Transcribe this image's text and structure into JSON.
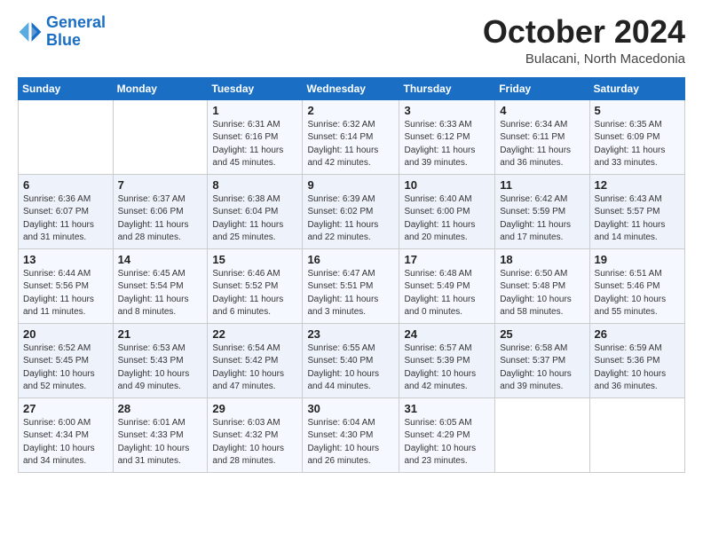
{
  "logo": {
    "line1": "General",
    "line2": "Blue"
  },
  "title": "October 2024",
  "subtitle": "Bulacani, North Macedonia",
  "days_header": [
    "Sunday",
    "Monday",
    "Tuesday",
    "Wednesday",
    "Thursday",
    "Friday",
    "Saturday"
  ],
  "weeks": [
    [
      {
        "day": "",
        "sunrise": "",
        "sunset": "",
        "daylight": ""
      },
      {
        "day": "",
        "sunrise": "",
        "sunset": "",
        "daylight": ""
      },
      {
        "day": "1",
        "sunrise": "Sunrise: 6:31 AM",
        "sunset": "Sunset: 6:16 PM",
        "daylight": "Daylight: 11 hours and 45 minutes."
      },
      {
        "day": "2",
        "sunrise": "Sunrise: 6:32 AM",
        "sunset": "Sunset: 6:14 PM",
        "daylight": "Daylight: 11 hours and 42 minutes."
      },
      {
        "day": "3",
        "sunrise": "Sunrise: 6:33 AM",
        "sunset": "Sunset: 6:12 PM",
        "daylight": "Daylight: 11 hours and 39 minutes."
      },
      {
        "day": "4",
        "sunrise": "Sunrise: 6:34 AM",
        "sunset": "Sunset: 6:11 PM",
        "daylight": "Daylight: 11 hours and 36 minutes."
      },
      {
        "day": "5",
        "sunrise": "Sunrise: 6:35 AM",
        "sunset": "Sunset: 6:09 PM",
        "daylight": "Daylight: 11 hours and 33 minutes."
      }
    ],
    [
      {
        "day": "6",
        "sunrise": "Sunrise: 6:36 AM",
        "sunset": "Sunset: 6:07 PM",
        "daylight": "Daylight: 11 hours and 31 minutes."
      },
      {
        "day": "7",
        "sunrise": "Sunrise: 6:37 AM",
        "sunset": "Sunset: 6:06 PM",
        "daylight": "Daylight: 11 hours and 28 minutes."
      },
      {
        "day": "8",
        "sunrise": "Sunrise: 6:38 AM",
        "sunset": "Sunset: 6:04 PM",
        "daylight": "Daylight: 11 hours and 25 minutes."
      },
      {
        "day": "9",
        "sunrise": "Sunrise: 6:39 AM",
        "sunset": "Sunset: 6:02 PM",
        "daylight": "Daylight: 11 hours and 22 minutes."
      },
      {
        "day": "10",
        "sunrise": "Sunrise: 6:40 AM",
        "sunset": "Sunset: 6:00 PM",
        "daylight": "Daylight: 11 hours and 20 minutes."
      },
      {
        "day": "11",
        "sunrise": "Sunrise: 6:42 AM",
        "sunset": "Sunset: 5:59 PM",
        "daylight": "Daylight: 11 hours and 17 minutes."
      },
      {
        "day": "12",
        "sunrise": "Sunrise: 6:43 AM",
        "sunset": "Sunset: 5:57 PM",
        "daylight": "Daylight: 11 hours and 14 minutes."
      }
    ],
    [
      {
        "day": "13",
        "sunrise": "Sunrise: 6:44 AM",
        "sunset": "Sunset: 5:56 PM",
        "daylight": "Daylight: 11 hours and 11 minutes."
      },
      {
        "day": "14",
        "sunrise": "Sunrise: 6:45 AM",
        "sunset": "Sunset: 5:54 PM",
        "daylight": "Daylight: 11 hours and 8 minutes."
      },
      {
        "day": "15",
        "sunrise": "Sunrise: 6:46 AM",
        "sunset": "Sunset: 5:52 PM",
        "daylight": "Daylight: 11 hours and 6 minutes."
      },
      {
        "day": "16",
        "sunrise": "Sunrise: 6:47 AM",
        "sunset": "Sunset: 5:51 PM",
        "daylight": "Daylight: 11 hours and 3 minutes."
      },
      {
        "day": "17",
        "sunrise": "Sunrise: 6:48 AM",
        "sunset": "Sunset: 5:49 PM",
        "daylight": "Daylight: 11 hours and 0 minutes."
      },
      {
        "day": "18",
        "sunrise": "Sunrise: 6:50 AM",
        "sunset": "Sunset: 5:48 PM",
        "daylight": "Daylight: 10 hours and 58 minutes."
      },
      {
        "day": "19",
        "sunrise": "Sunrise: 6:51 AM",
        "sunset": "Sunset: 5:46 PM",
        "daylight": "Daylight: 10 hours and 55 minutes."
      }
    ],
    [
      {
        "day": "20",
        "sunrise": "Sunrise: 6:52 AM",
        "sunset": "Sunset: 5:45 PM",
        "daylight": "Daylight: 10 hours and 52 minutes."
      },
      {
        "day": "21",
        "sunrise": "Sunrise: 6:53 AM",
        "sunset": "Sunset: 5:43 PM",
        "daylight": "Daylight: 10 hours and 49 minutes."
      },
      {
        "day": "22",
        "sunrise": "Sunrise: 6:54 AM",
        "sunset": "Sunset: 5:42 PM",
        "daylight": "Daylight: 10 hours and 47 minutes."
      },
      {
        "day": "23",
        "sunrise": "Sunrise: 6:55 AM",
        "sunset": "Sunset: 5:40 PM",
        "daylight": "Daylight: 10 hours and 44 minutes."
      },
      {
        "day": "24",
        "sunrise": "Sunrise: 6:57 AM",
        "sunset": "Sunset: 5:39 PM",
        "daylight": "Daylight: 10 hours and 42 minutes."
      },
      {
        "day": "25",
        "sunrise": "Sunrise: 6:58 AM",
        "sunset": "Sunset: 5:37 PM",
        "daylight": "Daylight: 10 hours and 39 minutes."
      },
      {
        "day": "26",
        "sunrise": "Sunrise: 6:59 AM",
        "sunset": "Sunset: 5:36 PM",
        "daylight": "Daylight: 10 hours and 36 minutes."
      }
    ],
    [
      {
        "day": "27",
        "sunrise": "Sunrise: 6:00 AM",
        "sunset": "Sunset: 4:34 PM",
        "daylight": "Daylight: 10 hours and 34 minutes."
      },
      {
        "day": "28",
        "sunrise": "Sunrise: 6:01 AM",
        "sunset": "Sunset: 4:33 PM",
        "daylight": "Daylight: 10 hours and 31 minutes."
      },
      {
        "day": "29",
        "sunrise": "Sunrise: 6:03 AM",
        "sunset": "Sunset: 4:32 PM",
        "daylight": "Daylight: 10 hours and 28 minutes."
      },
      {
        "day": "30",
        "sunrise": "Sunrise: 6:04 AM",
        "sunset": "Sunset: 4:30 PM",
        "daylight": "Daylight: 10 hours and 26 minutes."
      },
      {
        "day": "31",
        "sunrise": "Sunrise: 6:05 AM",
        "sunset": "Sunset: 4:29 PM",
        "daylight": "Daylight: 10 hours and 23 minutes."
      },
      {
        "day": "",
        "sunrise": "",
        "sunset": "",
        "daylight": ""
      },
      {
        "day": "",
        "sunrise": "",
        "sunset": "",
        "daylight": ""
      }
    ]
  ]
}
